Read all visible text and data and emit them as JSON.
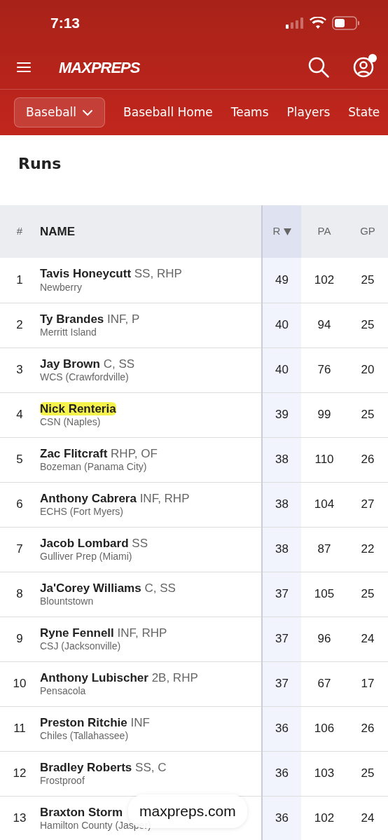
{
  "status_bar": {
    "time": "7:13"
  },
  "header": {
    "logo": "MAXPREPS",
    "notification_dot": true
  },
  "subnav": {
    "sport": "Baseball",
    "links": [
      "Baseball Home",
      "Teams",
      "Players",
      "State"
    ]
  },
  "title": "Runs",
  "table": {
    "columns": [
      {
        "label": "#",
        "sorted": false
      },
      {
        "label": "NAME",
        "sorted": false
      },
      {
        "label": "R",
        "sorted": true
      },
      {
        "label": "PA",
        "sorted": false
      },
      {
        "label": "GP",
        "sorted": false
      }
    ],
    "rows": [
      {
        "rank": "1",
        "name": "Tavis Honeycutt",
        "positions": "SS, RHP",
        "school": "Newberry",
        "r": "49",
        "pa": "102",
        "gp": "25",
        "highlighted": false
      },
      {
        "rank": "2",
        "name": "Ty Brandes",
        "positions": "INF, P",
        "school": "Merritt Island",
        "r": "40",
        "pa": "94",
        "gp": "25",
        "highlighted": false
      },
      {
        "rank": "3",
        "name": "Jay Brown",
        "positions": "C, SS",
        "school": "WCS (Crawfordville)",
        "r": "40",
        "pa": "76",
        "gp": "20",
        "highlighted": false
      },
      {
        "rank": "4",
        "name": "Nick Renteria",
        "school": "CSN (Naples)",
        "r": "39",
        "pa": "99",
        "gp": "25",
        "highlighted": true
      },
      {
        "rank": "5",
        "name": "Zac Flitcraft",
        "positions": "RHP, OF",
        "school": "Bozeman (Panama City)",
        "r": "38",
        "pa": "110",
        "gp": "26",
        "highlighted": false
      },
      {
        "rank": "6",
        "name": "Anthony Cabrera",
        "positions": "INF, RHP",
        "school": "ECHS (Fort Myers)",
        "r": "38",
        "pa": "104",
        "gp": "27",
        "highlighted": false
      },
      {
        "rank": "7",
        "name": "Jacob Lombard",
        "positions": "SS",
        "school": "Gulliver Prep (Miami)",
        "r": "38",
        "pa": "87",
        "gp": "22",
        "highlighted": false
      },
      {
        "rank": "8",
        "name": "Ja'Corey Williams",
        "positions": "C, SS",
        "school": "Blountstown",
        "r": "37",
        "pa": "105",
        "gp": "25",
        "highlighted": false
      },
      {
        "rank": "9",
        "name": "Ryne Fennell",
        "positions": "INF, RHP",
        "school": "CSJ (Jacksonville)",
        "r": "37",
        "pa": "96",
        "gp": "24",
        "highlighted": false
      },
      {
        "rank": "10",
        "name": "Anthony Lubischer",
        "positions": "2B, RHP",
        "school": "Pensacola",
        "r": "37",
        "pa": "67",
        "gp": "17",
        "highlighted": false
      },
      {
        "rank": "11",
        "name": "Preston Ritchie",
        "positions": "INF",
        "school": "Chiles (Tallahassee)",
        "r": "36",
        "pa": "106",
        "gp": "26",
        "highlighted": false
      },
      {
        "rank": "12",
        "name": "Bradley Roberts",
        "positions": "SS, C",
        "school": "Frostproof",
        "r": "36",
        "pa": "103",
        "gp": "25",
        "highlighted": false
      },
      {
        "rank": "13",
        "name": "Braxton Storm",
        "school": "Hamilton County (Jasper)",
        "r": "36",
        "pa": "102",
        "gp": "24",
        "highlighted": false
      }
    ]
  },
  "url_pill": "maxpreps.com"
}
